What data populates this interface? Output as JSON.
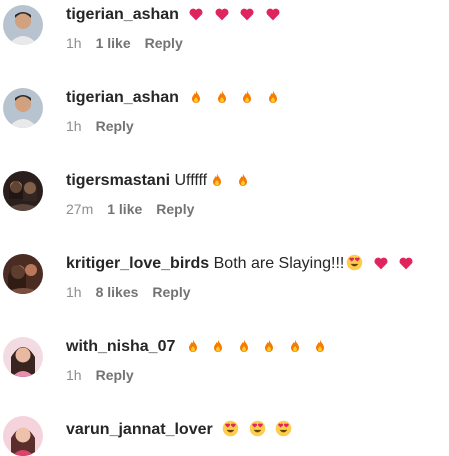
{
  "comments": [
    {
      "username": "tigerian_ashan",
      "text": "",
      "emojis": [
        "heart",
        "heart",
        "heart",
        "heart"
      ],
      "time": "1h",
      "likes": "1 like",
      "reply": "Reply",
      "avatar": "avatar-man-tiger"
    },
    {
      "username": "tigerian_ashan",
      "text": "",
      "emojis": [
        "fire",
        "fire",
        "fire",
        "fire"
      ],
      "time": "1h",
      "likes": "",
      "reply": "Reply",
      "avatar": "avatar-man-tiger"
    },
    {
      "username": "tigersmastani",
      "text": "Ufffff",
      "emojis": [
        "fire",
        "fire"
      ],
      "time": "27m",
      "likes": "1 like",
      "reply": "Reply",
      "avatar": "avatar-couple"
    },
    {
      "username": "kritiger_love_birds",
      "text": "Both are Slaying!!!",
      "emojis": [
        "heart-eyes",
        "heart",
        "heart"
      ],
      "time": "1h",
      "likes": "8 likes",
      "reply": "Reply",
      "avatar": "avatar-couple-2"
    },
    {
      "username": "with_nisha_07",
      "text": "",
      "emojis": [
        "fire",
        "fire",
        "fire",
        "fire",
        "fire",
        "fire"
      ],
      "time": "1h",
      "likes": "",
      "reply": "Reply",
      "avatar": "avatar-woman"
    },
    {
      "username": "varun_jannat_lover",
      "text": "",
      "emojis": [
        "heart-eyes",
        "heart-eyes",
        "heart-eyes"
      ],
      "time": "",
      "likes": "",
      "reply": "",
      "avatar": "avatar-woman-2"
    }
  ],
  "colors": {
    "heart": "#e0245e",
    "fire": "#f57c00",
    "fire_core": "#ffca28",
    "emoji_face": "#ffcc4d",
    "meta_text": "#737373"
  }
}
